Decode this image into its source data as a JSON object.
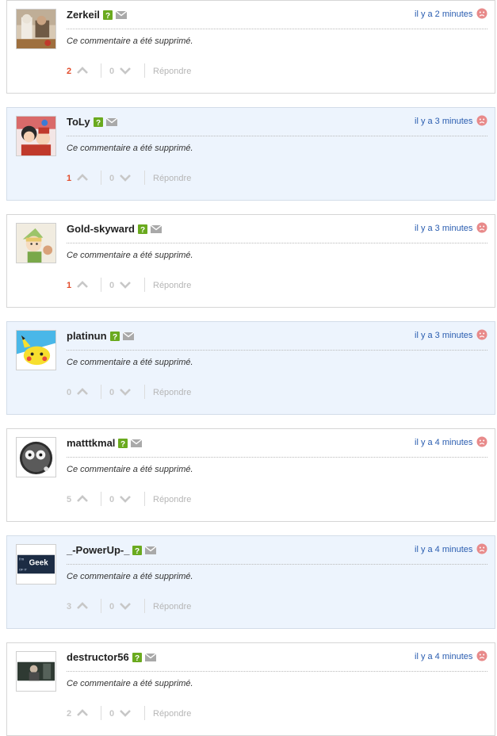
{
  "comments": [
    {
      "username": "Zerkeil",
      "time": "il y a 2 minutes",
      "text": "Ce commentaire a été supprimé.",
      "upvotes": "2",
      "downvotes": "0",
      "reply_label": "Répondre",
      "highlighted": false,
      "avatar": "avatar-zerkeil"
    },
    {
      "username": "ToLy",
      "time": "il y a 3 minutes",
      "text": "Ce commentaire a été supprimé.",
      "upvotes": "1",
      "downvotes": "0",
      "reply_label": "Répondre",
      "highlighted": true,
      "avatar": "avatar-toly"
    },
    {
      "username": "Gold-skyward",
      "time": "il y a 3 minutes",
      "text": "Ce commentaire a été supprimé.",
      "upvotes": "1",
      "downvotes": "0",
      "reply_label": "Répondre",
      "highlighted": false,
      "avatar": "avatar-gold-skyward"
    },
    {
      "username": "platinun",
      "time": "il y a 3 minutes",
      "text": "Ce commentaire a été supprimé.",
      "upvotes": "0",
      "downvotes": "0",
      "reply_label": "Répondre",
      "highlighted": true,
      "avatar": "avatar-platinun"
    },
    {
      "username": "matttkmal",
      "time": "il y a 4 minutes",
      "text": "Ce commentaire a été supprimé.",
      "upvotes": "5",
      "downvotes": "0",
      "reply_label": "Répondre",
      "highlighted": false,
      "avatar": "avatar-matttkmal"
    },
    {
      "username": "_-PowerUp-_",
      "time": "il y a 4 minutes",
      "text": "Ce commentaire a été supprimé.",
      "upvotes": "3",
      "downvotes": "0",
      "reply_label": "Répondre",
      "highlighted": true,
      "avatar": "avatar-powerup"
    },
    {
      "username": "destructor56",
      "time": "il y a 4 minutes",
      "text": "Ce commentaire a été supprimé.",
      "upvotes": "2",
      "downvotes": "0",
      "reply_label": "Répondre",
      "highlighted": false,
      "avatar": "avatar-destructor56"
    }
  ],
  "avatar_texts": {
    "powerup_line1": "I'm",
    "powerup_line2": "Geek",
    "powerup_line3": "OF IT"
  },
  "icons": {
    "badge": "help-badge-icon",
    "mail": "mail-icon",
    "upvote": "chevron-up-icon",
    "downvote": "chevron-down-icon",
    "report": "sad-face-icon"
  },
  "colors": {
    "link": "#2a5db0",
    "vote_positive": "#e24b2a",
    "vote_neutral": "#c7c7c7",
    "highlight_bg": "#edf4fd",
    "badge_green": "#6aaa1e",
    "report_red": "#e88a8a"
  }
}
